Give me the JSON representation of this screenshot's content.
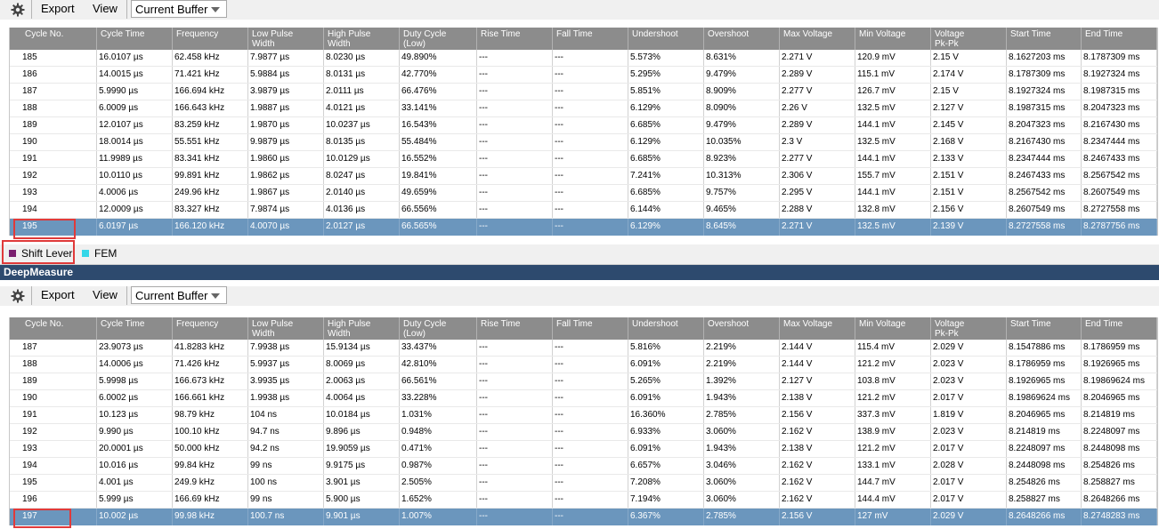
{
  "toolbar": {
    "settings_icon": "gear-icon",
    "export_label": "Export",
    "view_label": "View",
    "buffer_value": "Current Buffer"
  },
  "columns": [
    {
      "line1": "Cycle No.",
      "line2": ""
    },
    {
      "line1": "Cycle Time",
      "line2": ""
    },
    {
      "line1": "Frequency",
      "line2": ""
    },
    {
      "line1": "Low Pulse",
      "line2": "Width"
    },
    {
      "line1": "High Pulse",
      "line2": "Width"
    },
    {
      "line1": "Duty Cycle",
      "line2": "(Low)"
    },
    {
      "line1": "Rise Time",
      "line2": ""
    },
    {
      "line1": "Fall Time",
      "line2": ""
    },
    {
      "line1": "Undershoot",
      "line2": ""
    },
    {
      "line1": "Overshoot",
      "line2": ""
    },
    {
      "line1": "Max Voltage",
      "line2": ""
    },
    {
      "line1": "Min Voltage",
      "line2": ""
    },
    {
      "line1": "Voltage",
      "line2": "Pk-Pk"
    },
    {
      "line1": "Start Time",
      "line2": ""
    },
    {
      "line1": "End Time",
      "line2": ""
    }
  ],
  "table1": {
    "rows": [
      [
        "185",
        "16.0107 µs",
        "62.458 kHz",
        "7.9877 µs",
        "8.0230 µs",
        "49.890%",
        "---",
        "---",
        "5.573%",
        "8.631%",
        "2.271 V",
        "120.9 mV",
        "2.15 V",
        "8.1627203 ms",
        "8.1787309 ms"
      ],
      [
        "186",
        "14.0015 µs",
        "71.421 kHz",
        "5.9884 µs",
        "8.0131 µs",
        "42.770%",
        "---",
        "---",
        "5.295%",
        "9.479%",
        "2.289 V",
        "115.1 mV",
        "2.174 V",
        "8.1787309 ms",
        "8.1927324 ms"
      ],
      [
        "187",
        "5.9990 µs",
        "166.694 kHz",
        "3.9879 µs",
        "2.0111 µs",
        "66.476%",
        "---",
        "---",
        "5.851%",
        "8.909%",
        "2.277 V",
        "126.7 mV",
        "2.15 V",
        "8.1927324 ms",
        "8.1987315 ms"
      ],
      [
        "188",
        "6.0009 µs",
        "166.643 kHz",
        "1.9887 µs",
        "4.0121 µs",
        "33.141%",
        "---",
        "---",
        "6.129%",
        "8.090%",
        "2.26 V",
        "132.5 mV",
        "2.127 V",
        "8.1987315 ms",
        "8.2047323 ms"
      ],
      [
        "189",
        "12.0107 µs",
        "83.259 kHz",
        "1.9870 µs",
        "10.0237 µs",
        "16.543%",
        "---",
        "---",
        "6.685%",
        "9.479%",
        "2.289 V",
        "144.1 mV",
        "2.145 V",
        "8.2047323 ms",
        "8.2167430 ms"
      ],
      [
        "190",
        "18.0014 µs",
        "55.551 kHz",
        "9.9879 µs",
        "8.0135 µs",
        "55.484%",
        "---",
        "---",
        "6.129%",
        "10.035%",
        "2.3 V",
        "132.5 mV",
        "2.168 V",
        "8.2167430 ms",
        "8.2347444 ms"
      ],
      [
        "191",
        "11.9989 µs",
        "83.341 kHz",
        "1.9860 µs",
        "10.0129 µs",
        "16.552%",
        "---",
        "---",
        "6.685%",
        "8.923%",
        "2.277 V",
        "144.1 mV",
        "2.133 V",
        "8.2347444 ms",
        "8.2467433 ms"
      ],
      [
        "192",
        "10.0110 µs",
        "99.891 kHz",
        "1.9862 µs",
        "8.0247 µs",
        "19.841%",
        "---",
        "---",
        "7.241%",
        "10.313%",
        "2.306 V",
        "155.7 mV",
        "2.151 V",
        "8.2467433 ms",
        "8.2567542 ms"
      ],
      [
        "193",
        "4.0006 µs",
        "249.96 kHz",
        "1.9867 µs",
        "2.0140 µs",
        "49.659%",
        "---",
        "---",
        "6.685%",
        "9.757%",
        "2.295 V",
        "144.1 mV",
        "2.151 V",
        "8.2567542 ms",
        "8.2607549 ms"
      ],
      [
        "194",
        "12.0009 µs",
        "83.327 kHz",
        "7.9874 µs",
        "4.0136 µs",
        "66.556%",
        "---",
        "---",
        "6.144%",
        "9.465%",
        "2.288 V",
        "132.8 mV",
        "2.156 V",
        "8.2607549 ms",
        "8.2727558 ms"
      ],
      [
        "195",
        "6.0197 µs",
        "166.120 kHz",
        "4.0070 µs",
        "2.0127 µs",
        "66.565%",
        "---",
        "---",
        "6.129%",
        "8.645%",
        "2.271 V",
        "132.5 mV",
        "2.139 V",
        "8.2727558 ms",
        "8.2787756 ms"
      ]
    ]
  },
  "legend": {
    "items": [
      {
        "label": "Shift Lever",
        "color": "#7a1f6f"
      },
      {
        "label": "FEM",
        "color": "#35d7e8"
      }
    ]
  },
  "panel_title": "DeepMeasure",
  "table2": {
    "rows": [
      [
        "187",
        "23.9073 µs",
        "41.8283 kHz",
        "7.9938 µs",
        "15.9134 µs",
        "33.437%",
        "---",
        "---",
        "5.816%",
        "2.219%",
        "2.144 V",
        "115.4 mV",
        "2.029 V",
        "8.1547886 ms",
        "8.1786959 ms"
      ],
      [
        "188",
        "14.0006 µs",
        "71.426 kHz",
        "5.9937 µs",
        "8.0069 µs",
        "42.810%",
        "---",
        "---",
        "6.091%",
        "2.219%",
        "2.144 V",
        "121.2 mV",
        "2.023 V",
        "8.1786959 ms",
        "8.1926965 ms"
      ],
      [
        "189",
        "5.9998 µs",
        "166.673 kHz",
        "3.9935 µs",
        "2.0063 µs",
        "66.561%",
        "---",
        "---",
        "5.265%",
        "1.392%",
        "2.127 V",
        "103.8 mV",
        "2.023 V",
        "8.1926965 ms",
        "8.19869624 ms"
      ],
      [
        "190",
        "6.0002 µs",
        "166.661 kHz",
        "1.9938 µs",
        "4.0064 µs",
        "33.228%",
        "---",
        "---",
        "6.091%",
        "1.943%",
        "2.138 V",
        "121.2 mV",
        "2.017 V",
        "8.19869624 ms",
        "8.2046965 ms"
      ],
      [
        "191",
        "10.123 µs",
        "98.79 kHz",
        "104 ns",
        "10.0184 µs",
        "1.031%",
        "---",
        "---",
        "16.360%",
        "2.785%",
        "2.156 V",
        "337.3 mV",
        "1.819 V",
        "8.2046965 ms",
        "8.214819 ms"
      ],
      [
        "192",
        "9.990 µs",
        "100.10 kHz",
        "94.7 ns",
        "9.896 µs",
        "0.948%",
        "---",
        "---",
        "6.933%",
        "3.060%",
        "2.162 V",
        "138.9 mV",
        "2.023 V",
        "8.214819 ms",
        "8.2248097 ms"
      ],
      [
        "193",
        "20.0001 µs",
        "50.000 kHz",
        "94.2 ns",
        "19.9059 µs",
        "0.471%",
        "---",
        "---",
        "6.091%",
        "1.943%",
        "2.138 V",
        "121.2 mV",
        "2.017 V",
        "8.2248097 ms",
        "8.2448098 ms"
      ],
      [
        "194",
        "10.016 µs",
        "99.84 kHz",
        "99 ns",
        "9.9175 µs",
        "0.987%",
        "---",
        "---",
        "6.657%",
        "3.046%",
        "2.162 V",
        "133.1 mV",
        "2.028 V",
        "8.2448098 ms",
        "8.254826 ms"
      ],
      [
        "195",
        "4.001 µs",
        "249.9 kHz",
        "100 ns",
        "3.901 µs",
        "2.505%",
        "---",
        "---",
        "7.208%",
        "3.060%",
        "2.162 V",
        "144.7 mV",
        "2.017 V",
        "8.254826 ms",
        "8.258827 ms"
      ],
      [
        "196",
        "5.999 µs",
        "166.69 kHz",
        "99 ns",
        "5.900 µs",
        "1.652%",
        "---",
        "---",
        "7.194%",
        "3.060%",
        "2.162 V",
        "144.4 mV",
        "2.017 V",
        "8.258827 ms",
        "8.2648266 ms"
      ],
      [
        "197",
        "10.002 µs",
        "99.98 kHz",
        "100.7 ns",
        "9.901 µs",
        "1.007%",
        "---",
        "---",
        "6.367%",
        "2.785%",
        "2.156 V",
        "127 mV",
        "2.029 V",
        "8.2648266 ms",
        "8.2748283 ms"
      ]
    ]
  }
}
